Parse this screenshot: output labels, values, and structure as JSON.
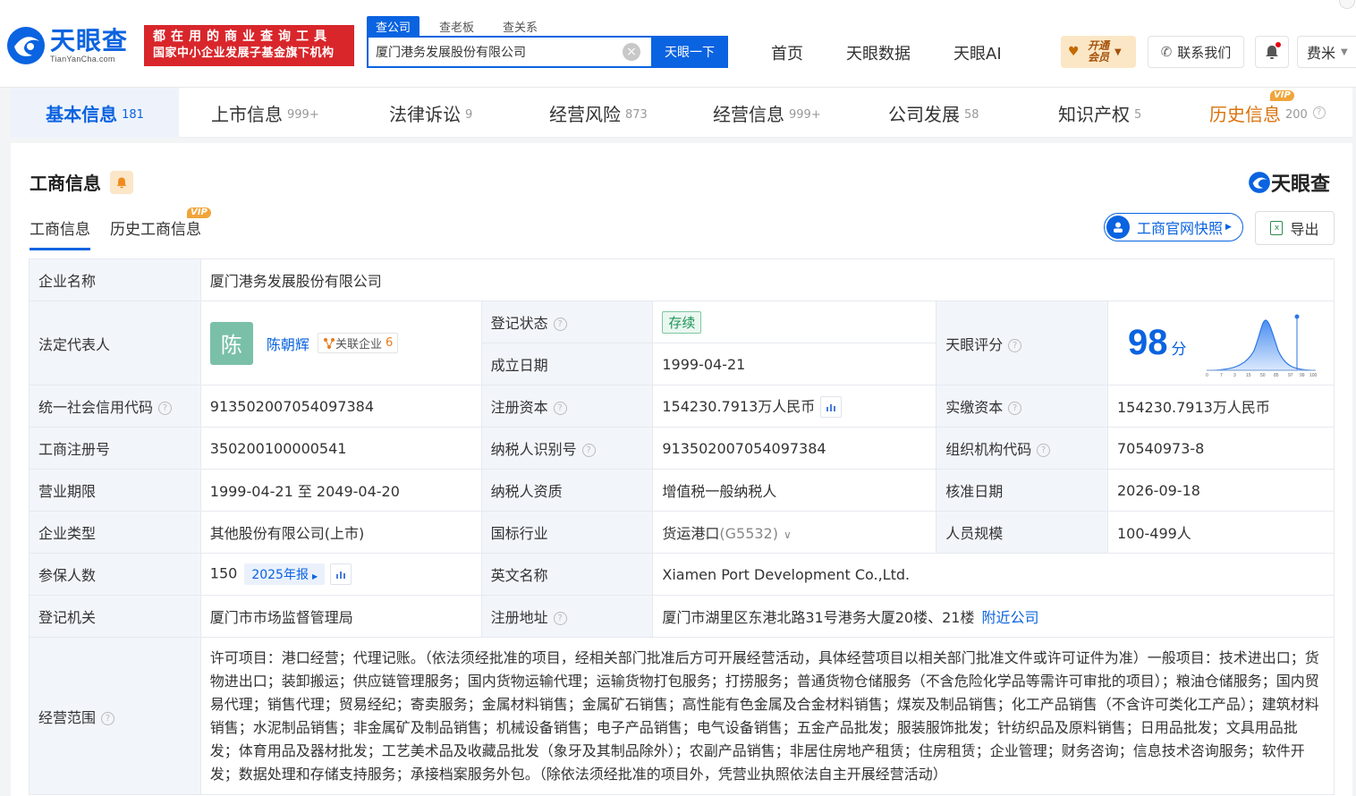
{
  "header": {
    "logo_cn": "天眼查",
    "logo_en": "TianYanCha.com",
    "slogan_line1": "都在用的商业查询工具",
    "slogan_line2": "国家中小企业发展子基金旗下机构",
    "search_tabs": [
      "查公司",
      "查老板",
      "查关系"
    ],
    "search_value": "厦门港务发展股份有限公司",
    "search_button": "天眼一下",
    "nav": [
      "首页",
      "天眼数据",
      "天眼AI"
    ],
    "vip_text_line1": "开通",
    "vip_text_line2": "会员",
    "contact": "联系我们",
    "user": "费米"
  },
  "tabs": [
    {
      "label": "基本信息",
      "count": "181"
    },
    {
      "label": "上市信息",
      "count": "999+"
    },
    {
      "label": "法律诉讼",
      "count": "9"
    },
    {
      "label": "经营风险",
      "count": "873"
    },
    {
      "label": "经营信息",
      "count": "999+"
    },
    {
      "label": "公司发展",
      "count": "58"
    },
    {
      "label": "知识产权",
      "count": "5"
    },
    {
      "label": "历史信息",
      "count": "200"
    }
  ],
  "vip_label": "VIP",
  "panel": {
    "title": "工商信息",
    "logo": "天眼查",
    "subtabs": [
      "工商信息",
      "历史工商信息"
    ],
    "snapshot_button": "工商官网快照",
    "export_button": "导出"
  },
  "info": {
    "company_name_label": "企业名称",
    "company_name": "厦门港务发展股份有限公司",
    "legal_rep_label": "法定代表人",
    "legal_rep_avatar": "陈",
    "legal_rep_name": "陈朝辉",
    "related_label": "关联企业",
    "related_count": "6",
    "reg_status_label": "登记状态",
    "reg_status": "存续",
    "found_date_label": "成立日期",
    "found_date": "1999-04-21",
    "score_label": "天眼评分",
    "score": "98",
    "score_unit": "分",
    "score_ticks": [
      "0",
      "7",
      "3",
      "15",
      "50",
      "85",
      "97",
      "99",
      "100"
    ],
    "credit_code_label": "统一社会信用代码",
    "credit_code": "913502007054097384",
    "reg_capital_label": "注册资本",
    "reg_capital": "154230.7913万人民币",
    "paid_capital_label": "实缴资本",
    "paid_capital": "154230.7913万人民币",
    "reg_no_label": "工商注册号",
    "reg_no": "350200100000541",
    "taxpayer_id_label": "纳税人识别号",
    "taxpayer_id": "913502007054097384",
    "org_code_label": "组织机构代码",
    "org_code": "70540973-8",
    "term_label": "营业期限",
    "term": "1999-04-21 至 2049-04-20",
    "taxpayer_qual_label": "纳税人资质",
    "taxpayer_qual": "增值税一般纳税人",
    "approve_date_label": "核准日期",
    "approve_date": "2026-09-18",
    "type_label": "企业类型",
    "type": "其他股份有限公司(上市)",
    "industry_label": "国标行业",
    "industry": "货运港口",
    "industry_code": "(G5532)",
    "staff_label": "人员规模",
    "staff": "100-499人",
    "insured_label": "参保人数",
    "insured": "150",
    "annual_report": "2025年报",
    "en_name_label": "英文名称",
    "en_name": "Xiamen Port Development Co.,Ltd.",
    "authority_label": "登记机关",
    "authority": "厦门市市场监督管理局",
    "address_label": "注册地址",
    "address": "厦门市湖里区东港北路31号港务大厦20楼、21楼",
    "nearby": "附近公司",
    "scope_label": "经营范围",
    "scope": "许可项目：港口经营；代理记账。（依法须经批准的项目，经相关部门批准后方可开展经营活动，具体经营项目以相关部门批准文件或许可证件为准）一般项目：技术进出口；货物进出口；装卸搬运；供应链管理服务；国内货物运输代理；运输货物打包服务；打捞服务；普通货物仓储服务（不含危险化学品等需许可审批的项目）；粮油仓储服务；国内贸易代理；销售代理；贸易经纪；寄卖服务；金属材料销售；金属矿石销售；高性能有色金属及合金材料销售；煤炭及制品销售；化工产品销售（不含许可类化工产品）；建筑材料销售；水泥制品销售；非金属矿及制品销售；机械设备销售；电子产品销售；电气设备销售；五金产品批发；服装服饰批发；针纺织品及原料销售；日用品批发；文具用品批发；体育用品及器材批发；工艺美术品及收藏品批发（象牙及其制品除外）；农副产品销售；非居住房地产租赁；住房租赁；企业管理；财务咨询；信息技术咨询服务；软件开发；数据处理和存储支持服务；承接档案服务外包。（除依法须经批准的项目外，凭营业执照依法自主开展经营活动）"
  },
  "colors": {
    "brand": "#0a63e0",
    "slogan_bg": "#d8262b",
    "history_tab": "#d9730d",
    "vip_badge": "#f0a53a"
  }
}
